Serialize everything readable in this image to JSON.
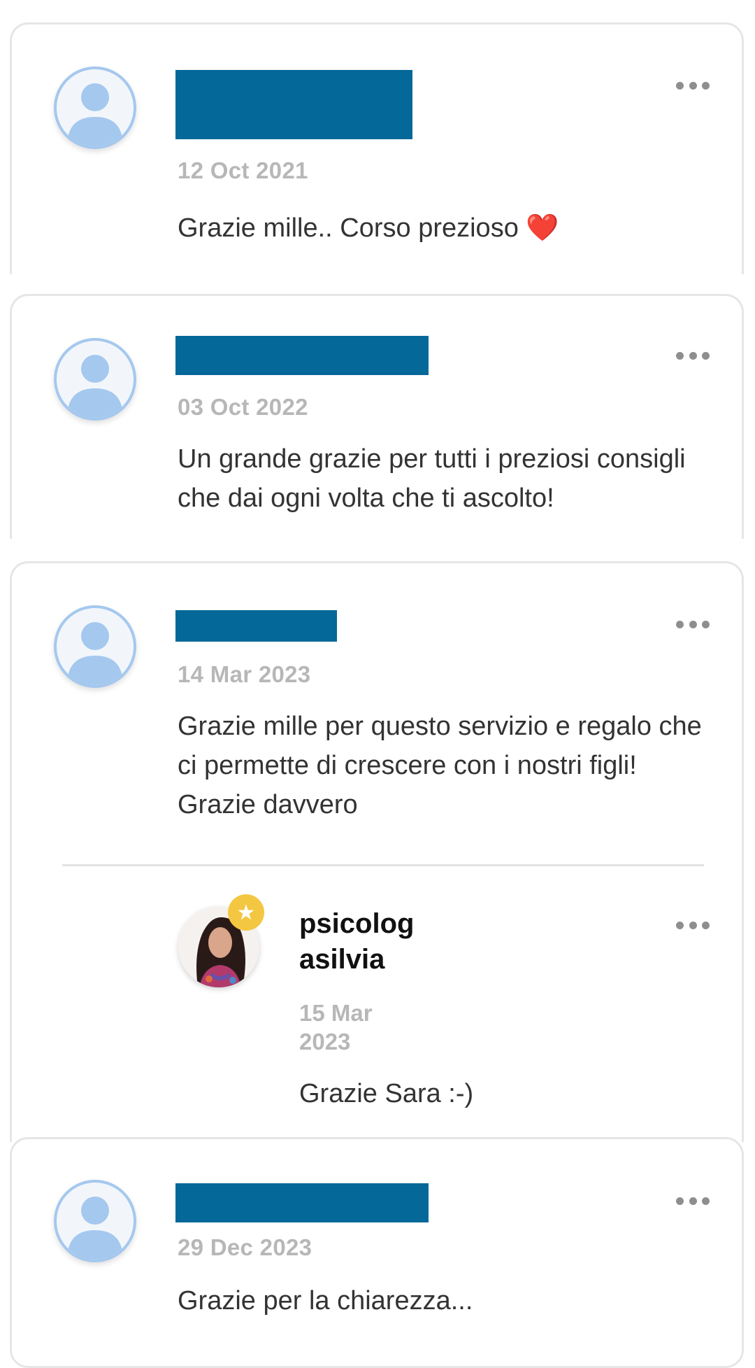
{
  "comments": [
    {
      "date": "12 Oct 2021",
      "text": "Grazie mille.. Corso prezioso",
      "emoji": "❤️"
    },
    {
      "date": "03 Oct 2022",
      "text": "Un grande grazie per tutti i preziosi consigli che dai ogni volta che ti ascolto!"
    },
    {
      "date": "14 Mar 2023",
      "text": "Grazie mille per questo servizio e regalo che ci permette di crescere con i nostri figli! Grazie davvero",
      "reply": {
        "author": "psicologasilvia",
        "author_line1": "psicolog",
        "author_line2": "asilvia",
        "date_line1": "15 Mar",
        "date_line2": "2023",
        "text": "Grazie Sara :-)",
        "badge_icon": "★"
      }
    },
    {
      "date": "29 Dec 2023",
      "text": "Grazie per la chiarezza..."
    }
  ],
  "colors": {
    "name_redaction": "#046899",
    "date_text": "#b7b7b7",
    "avatar_ring": "#a5c8ee",
    "badge": "#f4c742"
  },
  "icons": {
    "avatar": "default-user-avatar-icon",
    "more": "more-options-icon",
    "badge": "star-badge-icon"
  }
}
